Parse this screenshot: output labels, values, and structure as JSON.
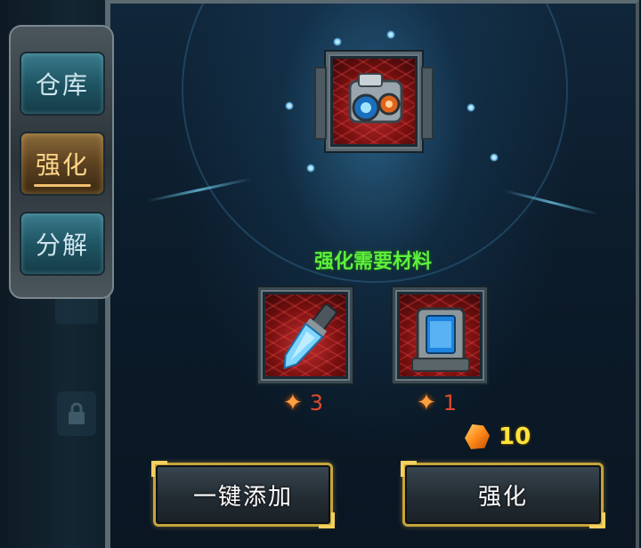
{
  "tabs": [
    {
      "id": "warehouse",
      "label": "仓库",
      "active": false
    },
    {
      "id": "enhance",
      "label": "强化",
      "active": true
    },
    {
      "id": "decompose",
      "label": "分解",
      "active": false
    }
  ],
  "target_item": {
    "icon": "camera-device-icon"
  },
  "materials": {
    "title": "强化需要材料",
    "items": [
      {
        "icon": "crystal-syringe-icon",
        "cost_icon": "star-shard-icon",
        "count": "3"
      },
      {
        "icon": "power-cell-icon",
        "cost_icon": "star-shard-icon",
        "count": "1"
      }
    ]
  },
  "currency": {
    "icon": "gold-gem-icon",
    "amount": "10"
  },
  "buttons": {
    "auto_add": "一键添加",
    "enhance": "强化"
  },
  "colors": {
    "title_green": "#5ef03a",
    "cost_red": "#e24a2a",
    "gold": "#ffe23a",
    "button_border": "#c6a43a"
  }
}
